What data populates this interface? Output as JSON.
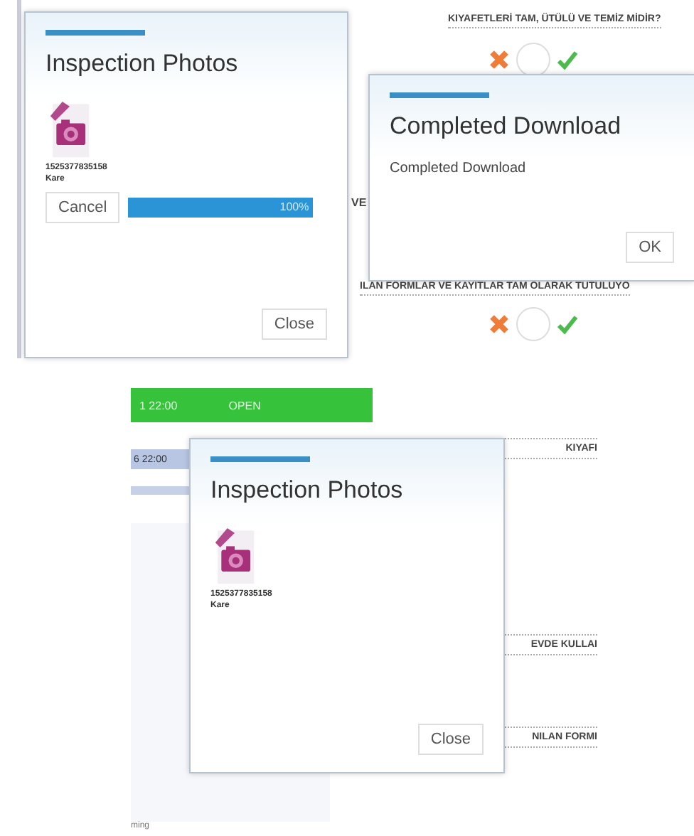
{
  "top_screen": {
    "questions": [
      {
        "text": "KIYAFETLERİ TAM, ÜTÜLÜ VE TEMİZ MİDİR?"
      },
      {
        "text": "ILAN FORMLAR VE KAYITLAR TAM OLARAK TUTULUYO"
      }
    ],
    "row_fragment": "VE",
    "photos_dialog": {
      "title": "Inspection Photos",
      "file": {
        "name": "1525377835158",
        "type": "Kare"
      },
      "progress": {
        "cancel": "Cancel",
        "level": 1,
        "reading": "100%"
      },
      "close": "Close"
    },
    "download_dialog": {
      "title": "Completed Download",
      "message": "Completed Download",
      "ok": "OK"
    }
  },
  "bottom_screen": {
    "green_bar": {
      "time": "1 22:00",
      "status": "OPEN"
    },
    "blue_row": "6 22:00",
    "labels": [
      "KIYAFI",
      "EVDE KULLAI",
      "NILAN FORMI"
    ],
    "footer": "ming",
    "photos_dialog": {
      "title": "Inspection Photos",
      "file": {
        "name": "1525377835158",
        "type": "Kare"
      },
      "close": "Close"
    }
  }
}
